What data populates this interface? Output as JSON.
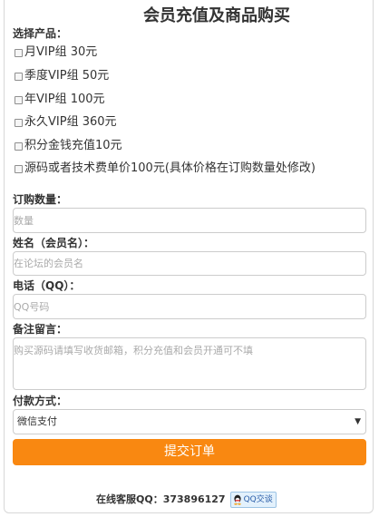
{
  "title": "会员充值及商品购买",
  "product_section": {
    "label": "选择产品：",
    "options": [
      "月VIP组 30元",
      "季度VIP组 50元",
      "年VIP组 100元",
      "永久VIP组 360元",
      "积分金钱充值10元",
      "源码或者技术费单价100元(具体价格在订购数量处修改)"
    ]
  },
  "quantity": {
    "label": "订购数量：",
    "placeholder": "数量"
  },
  "name": {
    "label": "姓名（会员名）：",
    "placeholder": "在论坛的会员名"
  },
  "phone": {
    "label": "电话（QQ）：",
    "placeholder": "QQ号码"
  },
  "remark": {
    "label": "备注留言：",
    "placeholder": "购买源码请填写收货邮箱，积分充值和会员开通可不填"
  },
  "payment": {
    "label": "付款方式：",
    "selected": "微信支付"
  },
  "submit_label": "提交订单",
  "footer": {
    "service_text": "在线客服QQ：373896127",
    "qq_button_label": "QQ交谈"
  },
  "colors": {
    "accent": "#f98811",
    "border": "#cccccc"
  }
}
